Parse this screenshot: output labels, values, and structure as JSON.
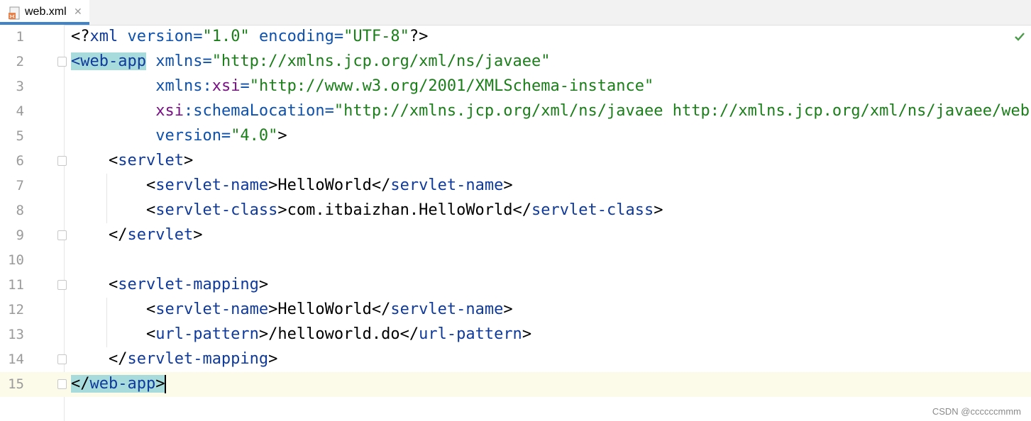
{
  "tab": {
    "label": "web.xml",
    "close": "✕"
  },
  "watermark": "CSDN @ccccccmmm",
  "lines": [
    {
      "n": "1"
    },
    {
      "n": "2"
    },
    {
      "n": "3"
    },
    {
      "n": "4"
    },
    {
      "n": "5"
    },
    {
      "n": "6"
    },
    {
      "n": "7"
    },
    {
      "n": "8"
    },
    {
      "n": "9"
    },
    {
      "n": "10"
    },
    {
      "n": "11"
    },
    {
      "n": "12"
    },
    {
      "n": "13"
    },
    {
      "n": "14"
    },
    {
      "n": "15"
    }
  ],
  "code": {
    "l1_a": "<?",
    "l1_b": "xml",
    "l1_c": " version=",
    "l1_d": "\"1.0\"",
    "l1_e": " encoding=",
    "l1_f": "\"UTF-8\"",
    "l1_g": "?>",
    "l2_a": "<web-app",
    "l2_b": " xmlns=",
    "l2_c": "\"http://xmlns.jcp.org/xml/ns/javaee\"",
    "l3_indent": "         ",
    "l3_a": "xmlns:",
    "l3_b": "xsi",
    "l3_c": "=",
    "l3_d": "\"http://www.w3.org/2001/XMLSchema-instance\"",
    "l4_indent": "         ",
    "l4_a": "xsi",
    "l4_b": ":schemaLocation=",
    "l4_c": "\"http://xmlns.jcp.org/xml/ns/javaee http://xmlns.jcp.org/xml/ns/javaee/web-ap",
    "l5_indent": "         ",
    "l5_a": "version=",
    "l5_b": "\"4.0\"",
    "l5_c": ">",
    "l6_indent": "    ",
    "l6_a": "<",
    "l6_b": "servlet",
    "l6_c": ">",
    "l7_indent": "        ",
    "l7_a": "<",
    "l7_b": "servlet-name",
    "l7_c": ">",
    "l7_d": "HelloWorld",
    "l7_e": "</",
    "l7_f": "servlet-name",
    "l7_g": ">",
    "l8_indent": "        ",
    "l8_a": "<",
    "l8_b": "servlet-class",
    "l8_c": ">",
    "l8_d": "com.itbaizhan.HelloWorld",
    "l8_e": "</",
    "l8_f": "servlet-class",
    "l8_g": ">",
    "l9_indent": "    ",
    "l9_a": "</",
    "l9_b": "servlet",
    "l9_c": ">",
    "l11_indent": "    ",
    "l11_a": "<",
    "l11_b": "servlet-mapping",
    "l11_c": ">",
    "l12_indent": "        ",
    "l12_a": "<",
    "l12_b": "servlet-name",
    "l12_c": ">",
    "l12_d": "HelloWorld",
    "l12_e": "</",
    "l12_f": "servlet-name",
    "l12_g": ">",
    "l13_indent": "        ",
    "l13_a": "<",
    "l13_b": "url-pattern",
    "l13_c": ">",
    "l13_d": "/helloworld.do",
    "l13_e": "</",
    "l13_f": "url-pattern",
    "l13_g": ">",
    "l14_indent": "    ",
    "l14_a": "</",
    "l14_b": "servlet-mapping",
    "l14_c": ">",
    "l15_a": "</",
    "l15_b": "web-app",
    "l15_c": ">"
  },
  "colors": {
    "tag": "#0f3a9c",
    "value": "#1a7f19",
    "namespace": "#7a0f86",
    "accent": "#4083c9"
  },
  "icons": {
    "file": "xml-file-icon",
    "status": "check-icon"
  }
}
